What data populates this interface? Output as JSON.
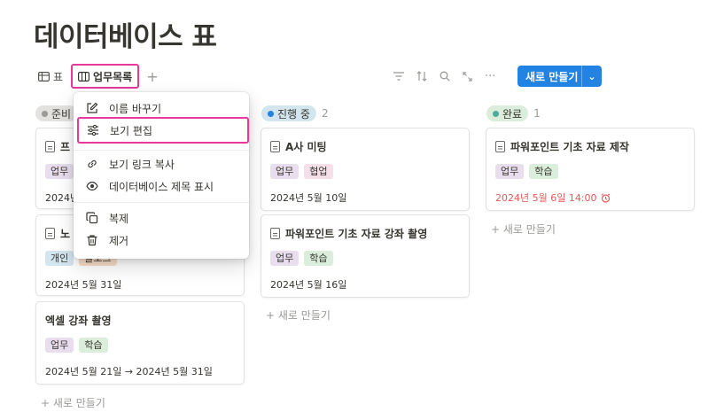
{
  "page": {
    "title": "데이터베이스 표"
  },
  "views": {
    "table_label": "표",
    "board_label": "업무목록",
    "add_label": "+"
  },
  "toolbar": {
    "more_label": "···",
    "new_label": "새로 만들기",
    "chevron": "⌄"
  },
  "colors": {
    "accent": "#2383e2",
    "highlight": "#e6399b",
    "overdue": "#eb5757"
  },
  "columns": [
    {
      "name": "준비",
      "dot": "#9b9a97",
      "bg": "#e3e2e0",
      "count": "",
      "new_label": "+ 새로 만들기"
    },
    {
      "name": "진행 중",
      "dot": "#2383e2",
      "bg": "#d3e5ef",
      "count": "2",
      "new_label": "+ 새로 만들기"
    },
    {
      "name": "완료",
      "dot": "#4dab9a",
      "bg": "#dbeddb",
      "count": "1",
      "new_label": "+ 새로 만들기"
    }
  ],
  "cards": {
    "c0a": {
      "title": "프",
      "tags": [
        "업무"
      ],
      "date": "2024년"
    },
    "c0b": {
      "title": "노",
      "tags": [
        "개인",
        "블로그"
      ],
      "date": "2024년 5월 31일"
    },
    "c0c": {
      "title": "엑셀 강좌 촬영",
      "tags": [
        "업무",
        "학습"
      ],
      "date": "2024년 5월 21일 → 2024년 5월 31일"
    },
    "c1a": {
      "title": "A사 미팅",
      "tags": [
        "업무",
        "협업"
      ],
      "date": "2024년 5월 10일"
    },
    "c1b": {
      "title": "파워포인트 기초 자료 강좌 촬영",
      "tags": [
        "업무",
        "학습"
      ],
      "date": "2024년 5월 16일"
    },
    "c2a": {
      "title": "파워포인트 기초 자료 제작",
      "tags": [
        "업무",
        "학습"
      ],
      "date": "2024년 5월 6일 14:00"
    }
  },
  "menu": {
    "rename": "이름 바꾸기",
    "edit_view": "보기 편집",
    "copy_link": "보기 링크 복사",
    "show_title": "데이터베이스 제목 표시",
    "duplicate": "복제",
    "delete": "제거"
  }
}
